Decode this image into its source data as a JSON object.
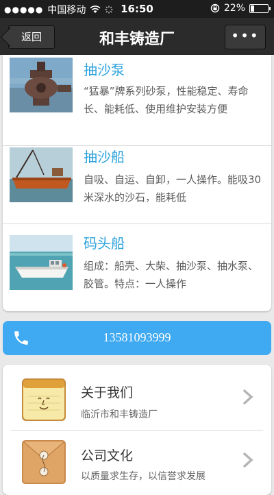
{
  "status_bar": {
    "signal_dots": "●●●●●",
    "carrier": "中国移动",
    "time": "16:50",
    "battery_percent": "22%",
    "battery_level": 0.22
  },
  "nav": {
    "back_label": "返回",
    "title": "和丰铸造厂",
    "more_label": "•••"
  },
  "products": [
    {
      "name": "抽沙泵",
      "desc": "“猛暴”牌系列砂泵，性能稳定、寿命长、能耗低、使用维护安装方便",
      "image": "sand-pump-photo"
    },
    {
      "name": "抽沙船",
      "desc": "自吸、自运、自卸，一人操作。能吸30米深水的沙石，能耗低",
      "image": "sand-dredger-photo"
    },
    {
      "name": "码头船",
      "desc": "组成：船壳、大柴、抽沙泵、抽水泵、胶管。特点：一人操作",
      "image": "dock-boat-photo"
    }
  ],
  "call": {
    "icon": "phone-icon",
    "number": "13581093999"
  },
  "menu": [
    {
      "title": "关于我们",
      "subtitle": "临沂市和丰铸造厂",
      "icon": "notepad-icon"
    },
    {
      "title": "公司文化",
      "subtitle": "以质量求生存，以信誉求发展",
      "icon": "envelope-icon"
    }
  ],
  "colors": {
    "accent_blue": "#29a1dd",
    "call_bar": "#3fa9f1",
    "nav_bg": "#2b2b2b"
  }
}
